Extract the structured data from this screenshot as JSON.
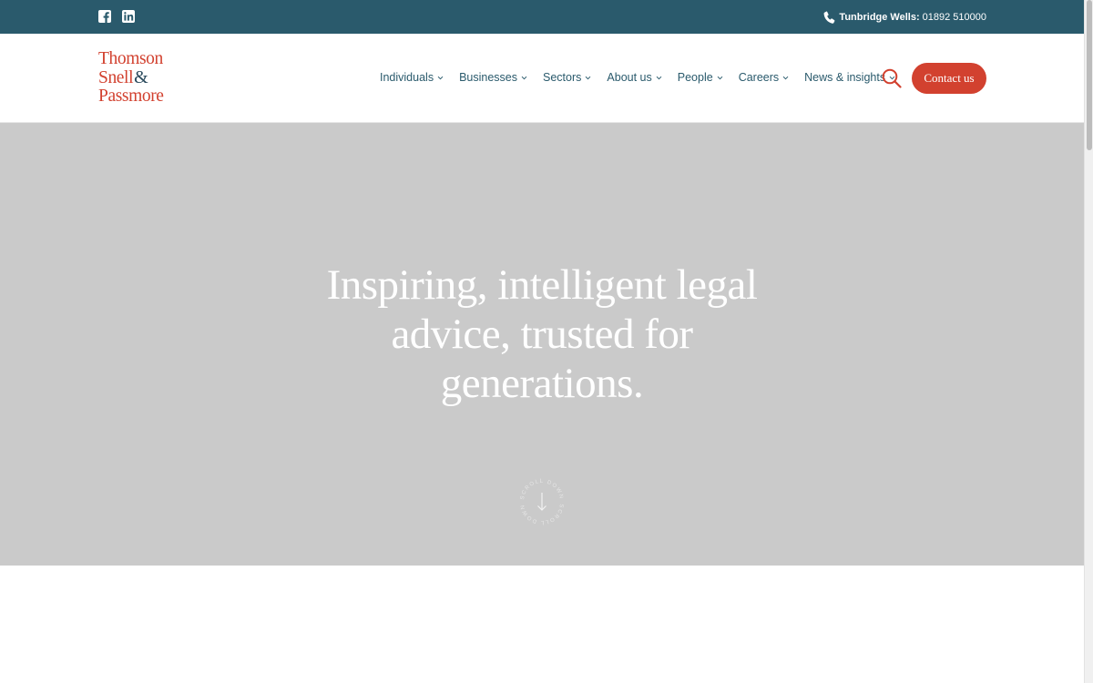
{
  "colors": {
    "topbar_bg": "#2a5a6c",
    "brand_red": "#d2412f",
    "nav_text": "#2a5a6c",
    "hero_bg": "#cacaca"
  },
  "topbar": {
    "social_icons": [
      "facebook-icon",
      "linkedin-icon"
    ],
    "phone_icon": "phone-icon",
    "phone_location": "Tunbridge Wells:",
    "phone_number": "01892 510000"
  },
  "header": {
    "logo": {
      "line1": "Thomson",
      "line2": "Snell",
      "amp": "&",
      "line3": "Passmore"
    },
    "nav": [
      {
        "label": "Individuals"
      },
      {
        "label": "Businesses"
      },
      {
        "label": "Sectors"
      },
      {
        "label": "About us"
      },
      {
        "label": "People"
      },
      {
        "label": "Careers"
      },
      {
        "label": "News & insights"
      }
    ],
    "search_icon": "search-icon",
    "contact_label": "Contact us"
  },
  "hero": {
    "title": "Inspiring, intelligent legal advice, trusted for generations.",
    "scroll_label": "SCROLL DOWN",
    "scroll_icon": "arrow-down-icon"
  }
}
